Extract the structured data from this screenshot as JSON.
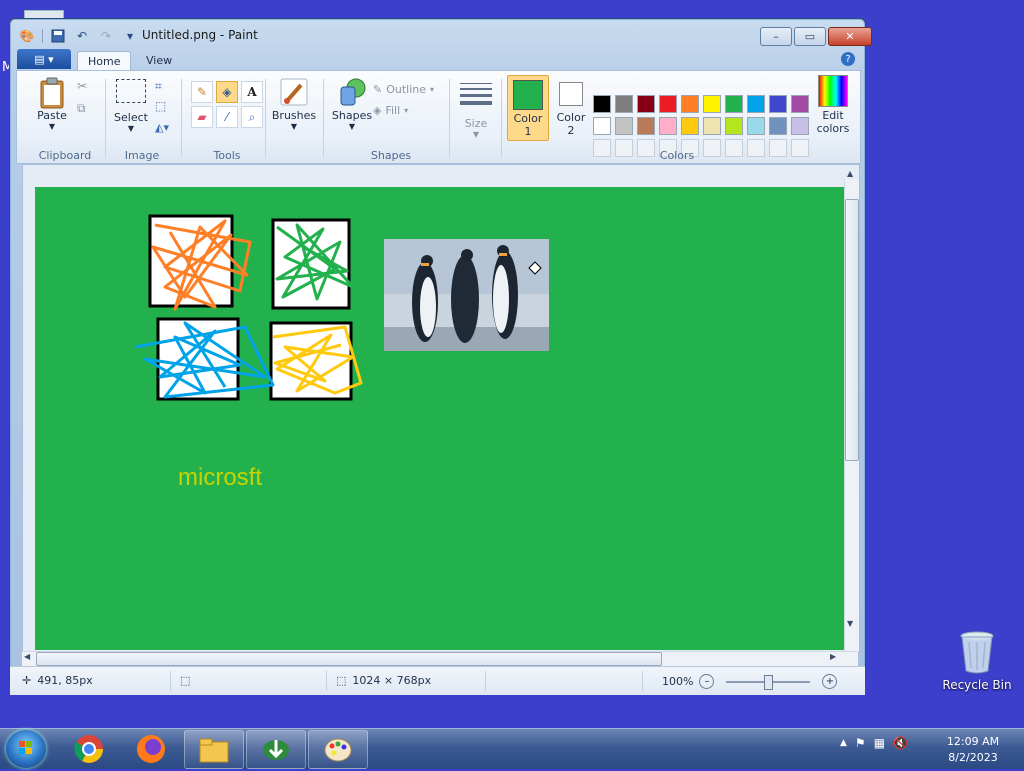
{
  "desktop": {
    "partial_label": "M",
    "recycle_bin_label": "Recycle Bin"
  },
  "window": {
    "title": "Untitled.png - Paint",
    "controls": {
      "minimize": "–",
      "maximize": "▭",
      "close": "✕"
    }
  },
  "ribbon": {
    "tabs": [
      {
        "label": "Home",
        "active": true
      },
      {
        "label": "View",
        "active": false
      }
    ],
    "file_tab_label": "▤ ▾",
    "groups": {
      "clipboard": {
        "label": "Clipboard",
        "paste": "Paste"
      },
      "image": {
        "label": "Image",
        "select": "Select"
      },
      "tools": {
        "label": "Tools"
      },
      "brushes": {
        "label": "Brushes"
      },
      "shapes": {
        "label": "Shapes",
        "shapes_btn": "Shapes",
        "outline": "Outline",
        "fill": "Fill"
      },
      "size": {
        "label": "Size"
      },
      "colors": {
        "label": "Colors",
        "color1": "Color",
        "color1_num": "1",
        "color2": "Color",
        "color2_num": "2",
        "edit": "Edit",
        "edit2": "colors",
        "color1_value": "#22b14c",
        "color2_value": "#ffffff",
        "palette_row1": [
          "#000000",
          "#7f7f7f",
          "#880015",
          "#ed1c24",
          "#ff7f27",
          "#fff200",
          "#22b14c",
          "#00a2e8",
          "#3f48cc",
          "#a349a4"
        ],
        "palette_row2": [
          "#ffffff",
          "#c3c3c3",
          "#b97a57",
          "#ffaec9",
          "#ffc90e",
          "#efe4b0",
          "#b5e61d",
          "#99d9ea",
          "#7092be",
          "#c8bfe7"
        ]
      }
    }
  },
  "canvas": {
    "background": "#22b14c",
    "text": "microsft",
    "text_color": "#c8d400"
  },
  "status": {
    "cursor_pos": "491, 85px",
    "image_size": "1024 × 768px",
    "zoom": "100%"
  },
  "taskbar": {
    "time": "12:09 AM",
    "date": "8/2/2023"
  }
}
